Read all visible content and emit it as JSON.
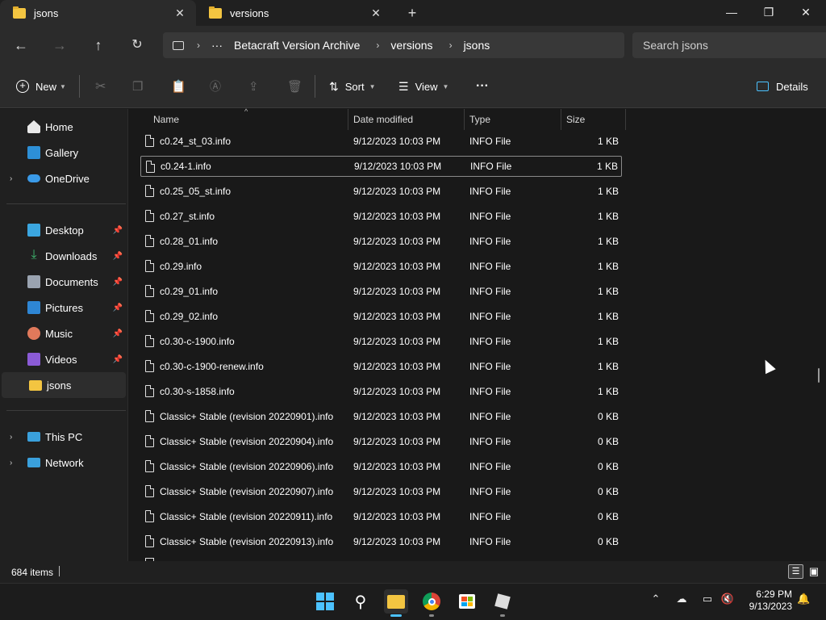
{
  "tabs": [
    {
      "label": "jsons"
    },
    {
      "label": "versions"
    }
  ],
  "breadcrumb": {
    "ellipsis": "···",
    "items": [
      "Betacraft Version Archive",
      "versions",
      "jsons"
    ]
  },
  "search": {
    "placeholder": "Search jsons"
  },
  "toolbar": {
    "new_label": "New",
    "sort_label": "Sort",
    "view_label": "View",
    "more_label": "···",
    "details_label": "Details"
  },
  "sidebar": {
    "items": [
      {
        "label": "Home",
        "icon": "home-icon"
      },
      {
        "label": "Gallery",
        "icon": "gallery-icon"
      },
      {
        "label": "OneDrive",
        "icon": "cloud-icon"
      },
      {
        "label": "Desktop",
        "icon": "desktop-icon"
      },
      {
        "label": "Downloads",
        "icon": "download-icon"
      },
      {
        "label": "Documents",
        "icon": "documents-icon"
      },
      {
        "label": "Pictures",
        "icon": "pictures-icon"
      },
      {
        "label": "Music",
        "icon": "music-icon"
      },
      {
        "label": "Videos",
        "icon": "videos-icon"
      },
      {
        "label": "jsons",
        "icon": "folder-icon"
      },
      {
        "label": "This PC",
        "icon": "pc-icon"
      },
      {
        "label": "Network",
        "icon": "network-icon"
      }
    ]
  },
  "columns": [
    "Name",
    "Date modified",
    "Type",
    "Size"
  ],
  "files": [
    {
      "name": "c0.24_st_03.info",
      "date": "9/12/2023 10:03 PM",
      "type": "INFO File",
      "size": "1 KB"
    },
    {
      "name": "c0.24-1.info",
      "date": "9/12/2023 10:03 PM",
      "type": "INFO File",
      "size": "1 KB"
    },
    {
      "name": "c0.25_05_st.info",
      "date": "9/12/2023 10:03 PM",
      "type": "INFO File",
      "size": "1 KB"
    },
    {
      "name": "c0.27_st.info",
      "date": "9/12/2023 10:03 PM",
      "type": "INFO File",
      "size": "1 KB"
    },
    {
      "name": "c0.28_01.info",
      "date": "9/12/2023 10:03 PM",
      "type": "INFO File",
      "size": "1 KB"
    },
    {
      "name": "c0.29.info",
      "date": "9/12/2023 10:03 PM",
      "type": "INFO File",
      "size": "1 KB"
    },
    {
      "name": "c0.29_01.info",
      "date": "9/12/2023 10:03 PM",
      "type": "INFO File",
      "size": "1 KB"
    },
    {
      "name": "c0.29_02.info",
      "date": "9/12/2023 10:03 PM",
      "type": "INFO File",
      "size": "1 KB"
    },
    {
      "name": "c0.30-c-1900.info",
      "date": "9/12/2023 10:03 PM",
      "type": "INFO File",
      "size": "1 KB"
    },
    {
      "name": "c0.30-c-1900-renew.info",
      "date": "9/12/2023 10:03 PM",
      "type": "INFO File",
      "size": "1 KB"
    },
    {
      "name": "c0.30-s-1858.info",
      "date": "9/12/2023 10:03 PM",
      "type": "INFO File",
      "size": "1 KB"
    },
    {
      "name": "Classic+ Stable (revision 20220901).info",
      "date": "9/12/2023 10:03 PM",
      "type": "INFO File",
      "size": "0 KB"
    },
    {
      "name": "Classic+ Stable (revision 20220904).info",
      "date": "9/12/2023 10:03 PM",
      "type": "INFO File",
      "size": "0 KB"
    },
    {
      "name": "Classic+ Stable (revision 20220906).info",
      "date": "9/12/2023 10:03 PM",
      "type": "INFO File",
      "size": "0 KB"
    },
    {
      "name": "Classic+ Stable (revision 20220907).info",
      "date": "9/12/2023 10:03 PM",
      "type": "INFO File",
      "size": "0 KB"
    },
    {
      "name": "Classic+ Stable (revision 20220911).info",
      "date": "9/12/2023 10:03 PM",
      "type": "INFO File",
      "size": "0 KB"
    },
    {
      "name": "Classic+ Stable (revision 20220913).info",
      "date": "9/12/2023 10:03 PM",
      "type": "INFO File",
      "size": "0 KB"
    }
  ],
  "status": {
    "item_count": "684 items"
  },
  "clock": {
    "time": "6:29 PM",
    "date": "9/13/2023"
  },
  "colors": {
    "folder": "#f3c541",
    "accent": "#4cc2ff"
  }
}
